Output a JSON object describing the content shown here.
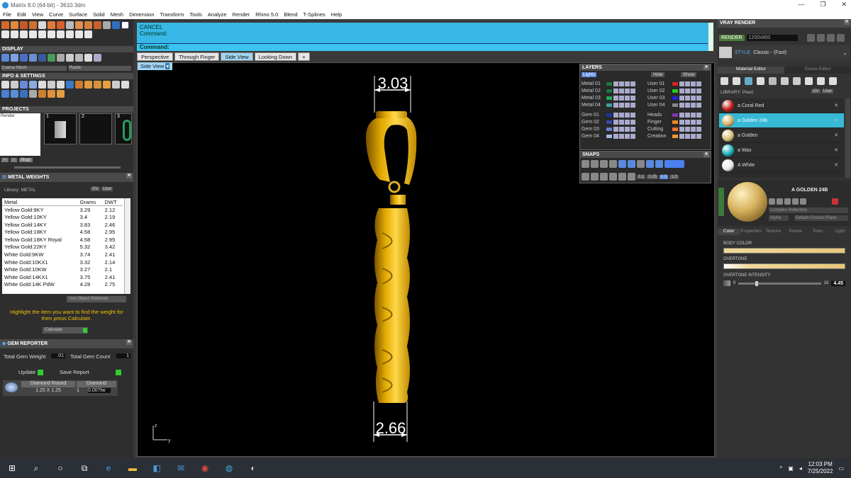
{
  "title": "Matrix 8.0 (64-bit) - 3610.3dm",
  "menu": [
    "File",
    "Edit",
    "View",
    "Curve",
    "Surface",
    "Solid",
    "Mesh",
    "Dimension",
    "Transform",
    "Tools",
    "Analyze",
    "Render",
    "Rhino 5.0",
    "Blend",
    "T-Splines",
    "Help"
  ],
  "left": {
    "display": "DISPLAY",
    "display_items": [
      "Coarse Mesh",
      "Plastic"
    ],
    "info": "INFO & SETTINGS",
    "projects": "PROJECTS",
    "projects_label": "Render",
    "project_nums": [
      "1",
      "2",
      "3"
    ],
    "magn": "Magr",
    "metal_weights": "METAL WEIGHTS",
    "library": "Library: METAL",
    "lib_btns": [
      "GV",
      "User"
    ],
    "table_headers": [
      "Metal",
      "Grams",
      "DWT"
    ],
    "metals": [
      [
        "Yellow Gold:9KY",
        "3.29",
        "2.12"
      ],
      [
        "Yellow Gold:10KY",
        "3.4",
        "2.19"
      ],
      [
        "Yellow Gold:14KY",
        "3.83",
        "2.46"
      ],
      [
        "Yellow Gold:18KY",
        "4.58",
        "2.95"
      ],
      [
        "Yellow Gold:18KY Royal",
        "4.58",
        "2.95"
      ],
      [
        "Yellow Gold:22KY",
        "5.32",
        "3.42"
      ],
      [
        "White Gold:9KW",
        "3.74",
        "2.41"
      ],
      [
        "White Gold:10KX1",
        "3.32",
        "2.14"
      ],
      [
        "White Gold:10KW",
        "3.27",
        "2.1"
      ],
      [
        "White Gold:14KX1",
        "3.75",
        "2.41"
      ],
      [
        "White Gold:14K PdW",
        "4.28",
        "2.75"
      ]
    ],
    "use_object": "Use Object Materials",
    "hint": "Highlight the item you want to find the weight for then press Calculate.",
    "calculate": "Calculate",
    "gem_reporter": "GEM REPORTER",
    "total_gem_weight_label": "Total Gem Weight",
    "total_gem_weight": ".01",
    "total_gem_count_label": "Total Gem Count",
    "total_gem_count": "1",
    "update": "Update",
    "save_report": "Save Report",
    "gem_name": "Diamond Round",
    "gem_size": "1.25 X 1.25",
    "gem_type": "Diamond",
    "gem_count": "1",
    "gem_weight": "0.007tw"
  },
  "command": {
    "line1": "CANCEL",
    "line2": "Command:",
    "prompt": "Command:"
  },
  "tabs": [
    "Perspective",
    "Through Finger",
    "Side View",
    "Looking Down",
    "+"
  ],
  "viewport": {
    "label": "Side View",
    "dim_top": "3.03",
    "dim_bottom": "2.66",
    "axis_z": "z",
    "axis_y": "y"
  },
  "layers": {
    "title": "LAYERS",
    "lights": "Lights",
    "hide": "Hide",
    "show": "Show",
    "left": [
      {
        "name": "Metal 01",
        "color": "#1a7a3a"
      },
      {
        "name": "Metal 02",
        "color": "#1a7a3a"
      },
      {
        "name": "Metal 03",
        "color": "#22aa55"
      },
      {
        "name": "Metal 04",
        "color": "#3aa0a0"
      },
      {
        "name": "Gem 01",
        "color": "#1a3aa0"
      },
      {
        "name": "Gem 02",
        "color": "#3a4ab0"
      },
      {
        "name": "Gem 03",
        "color": "#6a80d0"
      },
      {
        "name": "Gem 04",
        "color": "#a0b8e8"
      }
    ],
    "right": [
      {
        "name": "User 01",
        "color": "#dd2222"
      },
      {
        "name": "User 02",
        "color": "#22cc22"
      },
      {
        "name": "User 03",
        "color": "#2222dd"
      },
      {
        "name": "User 04",
        "color": "#888888"
      },
      {
        "name": "Heads",
        "color": "#8833aa"
      },
      {
        "name": "Finger",
        "color": "#ee8822"
      },
      {
        "name": "Cutting",
        "color": "#ee7733"
      },
      {
        "name": "Creation",
        "color": "#ee9933"
      }
    ]
  },
  "snaps": {
    "title": "SNAPS",
    "values": [
      "0.1",
      "0.25",
      "0.5",
      "1.0"
    ]
  },
  "right": {
    "vray": "VRAY RENDER",
    "render": "RENDER",
    "resolution": "1200x900",
    "style_label": "STYLE",
    "style": "Classic - (Fast)",
    "mat_editor": "Material Editor",
    "scene_editor": "Scene Editor",
    "library": "LIBRARY: Pearl",
    "lib_btns": [
      "GV",
      "User"
    ],
    "materials": [
      {
        "name": "a Coral Red",
        "color": "#c01818"
      },
      {
        "name": "a Golden 24b",
        "color": "#d4b060"
      },
      {
        "name": "a Golden",
        "color": "#d6bf70"
      },
      {
        "name": "a Wax",
        "color": "#18b0b8"
      },
      {
        "name": "A White",
        "color": "#e8e8e8"
      }
    ],
    "selected_mat": "A GOLDEN 24B",
    "complex": "Complex Reflection",
    "alpha": "Alpha",
    "ground": "Default Ground Plane",
    "subtabs": [
      "Color",
      "Properties",
      "Texture",
      "Scene",
      "Toon",
      "Light"
    ],
    "body_color": "BODY COLOR",
    "overtone": "OVERTONE",
    "overtone_intensity": "OVERTONE INTENSITY",
    "oi_min": "0",
    "oi_max": "10",
    "oi_value": "4.45"
  },
  "taskbar": {
    "time": "12:03 PM",
    "date": "7/25/2022"
  }
}
